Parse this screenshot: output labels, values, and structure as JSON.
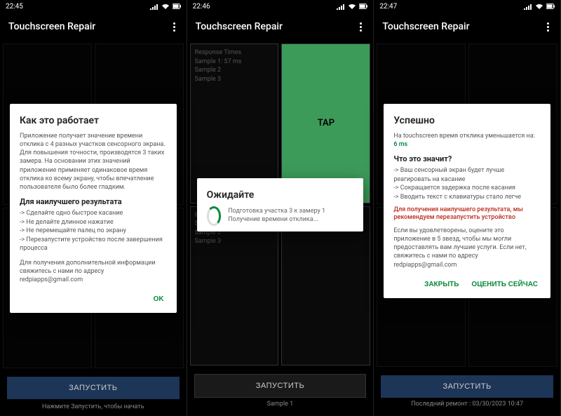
{
  "screens": [
    {
      "status": {
        "time": "22:45"
      },
      "app_title": "Touchscreen Repair",
      "dialog": {
        "title": "Как это работает",
        "body": "Приложение получает значение времени отклика с 4 разных участков сенсорного экрана. Для повышения точности, производятся 3 таких замера. На основании этих значений приложение применяет одинаковое время отклика ко всему экрану, чтобы впечатление пользователя было более гладким.",
        "sub": "Для наилучшего результата",
        "tips": [
          "-> Сделайте одно быстрое касание",
          "-> Не делайте длинное нажатие",
          "-> Не перемещайте палец по экрану",
          "-> Перезапустите устройство после завершения процесса"
        ],
        "footer": "Для получения дополнительной информации свяжитесь с нами по адресу redpiapps@gmail.com",
        "ok": "OK"
      },
      "launch": "ЗАПУСТИТЬ",
      "hint": "Нажмите Запустить, чтобы начать"
    },
    {
      "status": {
        "time": "22:46"
      },
      "app_title": "Touchscreen Repair",
      "cell_info": {
        "line1": "Response Times",
        "line2": "Sample 1: 57 ms",
        "line3": "Sample 2",
        "line4": "Sample 3"
      },
      "tap_label": "TAP",
      "dialog": {
        "title": "Ожидайте",
        "text": "Подготовка участка 3 к замеру 1 Получение времени отклика..."
      },
      "launch": "ЗАПУСТИТЬ",
      "footer": "Sample 1"
    },
    {
      "status": {
        "time": "22:47"
      },
      "app_title": "Touchscreen Repair",
      "dialog": {
        "title": "Успешно",
        "result_prefix": "На touchscreen время отклика уменьшается на: ",
        "result_value": "6 ms",
        "sub": "Что это значит?",
        "benefits": [
          "-> Ваш сенсорный экран будет лучше реагировать на касание",
          "-> Сокращается задержка после касания",
          "-> Вводить текст с клавиатуры стало легче"
        ],
        "warning": "Для получения наилучшего результата, мы рекомендуем перезапустить устройство",
        "rate_text": "Если вы удовлетворены, оцените это приложение в 5 звезд, чтобы мы могли предоставлять вам лучшие услуги. Если нет, свяжитесь с нами по адресу redpiapps@gmail.com",
        "close": "ЗАКРЫТЬ",
        "rate": "ОЦЕНИТЬ СЕЙЧАС"
      },
      "launch": "ЗАПУСТИТЬ",
      "footer": "Последний ремонт : 03/30/2023 10:47"
    }
  ]
}
